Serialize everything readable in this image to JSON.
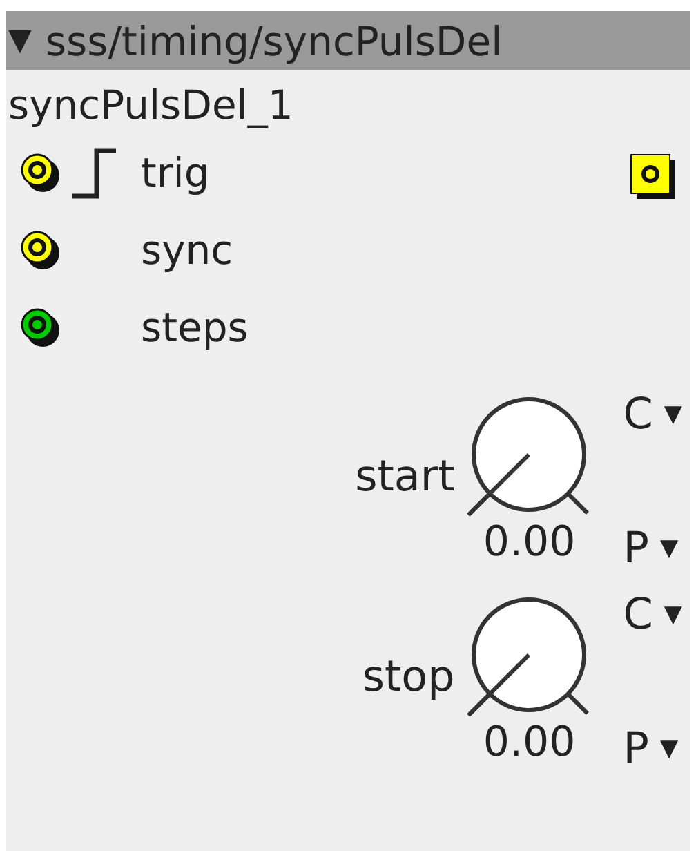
{
  "title": {
    "caret": "▼",
    "text": "sss/timing/syncPulsDel"
  },
  "instance_name": "syncPulsDel_1",
  "inlets": [
    {
      "name": "trig",
      "kind": "trig",
      "color": "#ffff00"
    },
    {
      "name": "sync",
      "kind": "plain",
      "color": "#ffff00"
    },
    {
      "name": "steps",
      "kind": "plain",
      "color": "#00cc00"
    }
  ],
  "outlets": [
    {
      "color": "#ffff00"
    }
  ],
  "params": [
    {
      "label": "start",
      "value": "0.00",
      "top_menu": {
        "text": "C",
        "caret": "▼"
      },
      "bottom_menu": {
        "text": "P",
        "caret": "▼"
      }
    },
    {
      "label": "stop",
      "value": "0.00",
      "top_menu": {
        "text": "C",
        "caret": "▼"
      },
      "bottom_menu": {
        "text": "P",
        "caret": "▼"
      }
    }
  ]
}
